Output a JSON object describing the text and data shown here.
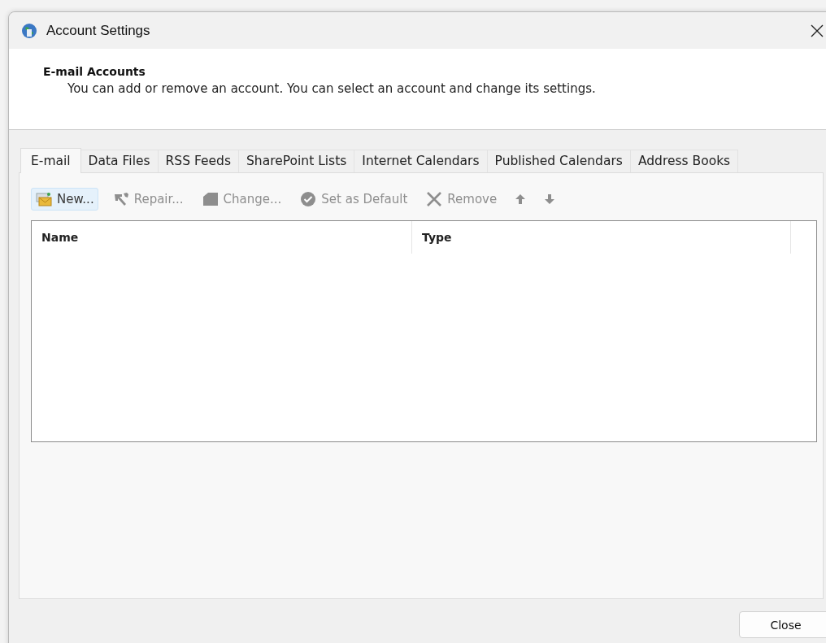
{
  "window": {
    "title": "Account Settings"
  },
  "header": {
    "title": "E-mail Accounts",
    "description": "You can add or remove an account. You can select an account and change its settings."
  },
  "tabs": [
    {
      "label": "E-mail",
      "selected": true
    },
    {
      "label": "Data Files",
      "selected": false
    },
    {
      "label": "RSS Feeds",
      "selected": false
    },
    {
      "label": "SharePoint Lists",
      "selected": false
    },
    {
      "label": "Internet Calendars",
      "selected": false
    },
    {
      "label": "Published Calendars",
      "selected": false
    },
    {
      "label": "Address Books",
      "selected": false
    }
  ],
  "toolbar": [
    {
      "kind": "new",
      "label": "New...",
      "disabled": false,
      "hovered": true
    },
    {
      "kind": "repair",
      "label": "Repair...",
      "disabled": true,
      "hovered": false
    },
    {
      "kind": "change",
      "label": "Change...",
      "disabled": true,
      "hovered": false
    },
    {
      "kind": "default",
      "label": "Set as Default",
      "disabled": true,
      "hovered": false
    },
    {
      "kind": "remove",
      "label": "Remove",
      "disabled": true,
      "hovered": false
    },
    {
      "kind": "up",
      "disabled": true,
      "hovered": false
    },
    {
      "kind": "down",
      "disabled": true,
      "hovered": false
    }
  ],
  "table": {
    "columns": [
      "Name",
      "Type"
    ]
  },
  "buttons": [
    "Close"
  ]
}
